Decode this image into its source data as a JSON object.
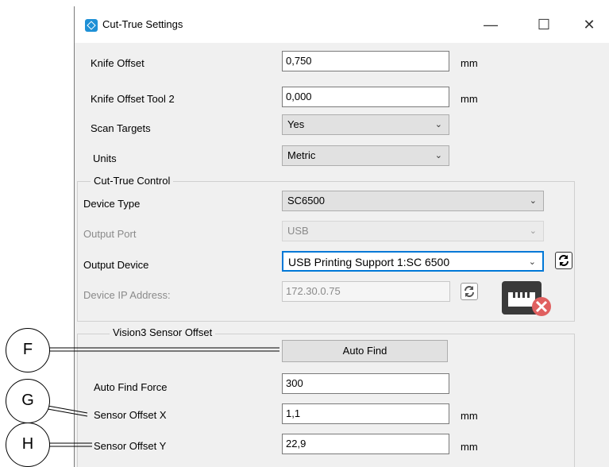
{
  "window": {
    "title": "Cut-True Settings",
    "icon": "app-logo-icon",
    "minimize_glyph": "—",
    "maximize_glyph": "☐",
    "close_glyph": "✕"
  },
  "fields": {
    "knife_offset": {
      "label": "Knife Offset",
      "value": "0,750",
      "unit": "mm"
    },
    "knife_offset_tool2": {
      "label": "Knife Offset Tool 2",
      "value": "0,000",
      "unit": "mm"
    },
    "scan_targets": {
      "label": "Scan Targets",
      "value": "Yes"
    },
    "units": {
      "label": "Units",
      "value": "Metric"
    }
  },
  "cut_true_control": {
    "title": "Cut-True Control",
    "device_type": {
      "label": "Device Type",
      "value": "SC6500"
    },
    "output_port": {
      "label": "Output Port",
      "value": "USB"
    },
    "output_device": {
      "label": "Output Device",
      "value": "USB Printing Support 1:SC 6500"
    },
    "device_ip": {
      "label": "Device IP Address:",
      "value": "172.30.0.75"
    }
  },
  "vision3": {
    "title": "Vision3 Sensor Offset",
    "auto_find_button": "Auto Find",
    "auto_find_force": {
      "label": "Auto Find Force",
      "value": "300"
    },
    "sensor_offset_x": {
      "label": "Sensor Offset X",
      "value": "1,1",
      "unit": "mm"
    },
    "sensor_offset_y": {
      "label": "Sensor Offset Y",
      "value": "22,9",
      "unit": "mm"
    }
  },
  "callouts": {
    "f": "F",
    "g": "G",
    "h": "H"
  },
  "colors": {
    "accent": "#0078d7",
    "error": "#e06060",
    "window_bg": "#f0f0f0"
  }
}
